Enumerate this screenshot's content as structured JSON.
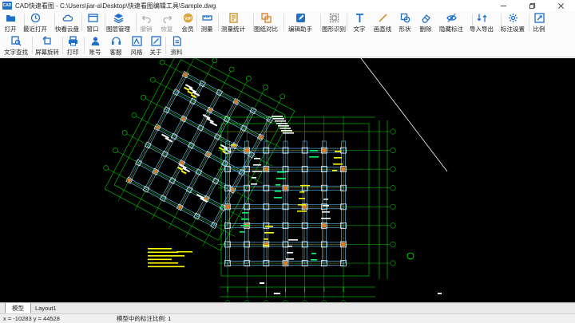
{
  "window": {
    "logo_text": "CAD",
    "title": "CAD快速看图 - C:\\Users\\jiar-a\\Desktop\\快速看图编辑工具\\Sample.dwg"
  },
  "toolbar": {
    "row1": [
      {
        "key": "open",
        "label": "打开",
        "icon": "folder-icon",
        "color": "#1f6fc9",
        "enabled": true
      },
      {
        "key": "recent",
        "label": "最近打开",
        "icon": "clock-icon",
        "color": "#1f6fc9",
        "enabled": true
      },
      {
        "key": "cloud",
        "label": "快看云盘",
        "icon": "cloud-icon",
        "color": "#1f6fc9",
        "enabled": true
      },
      {
        "key": "window",
        "label": "窗口",
        "icon": "window-icon",
        "color": "#1f6fc9",
        "enabled": true
      },
      {
        "key": "layers",
        "label": "图层管理",
        "icon": "layers-icon",
        "color": "#1f6fc9",
        "enabled": true
      },
      {
        "key": "undo",
        "label": "撤销",
        "icon": "undo-icon",
        "color": "#b0b0b0",
        "enabled": false
      },
      {
        "key": "redo",
        "label": "恢复",
        "icon": "redo-icon",
        "color": "#b0b0b0",
        "enabled": false
      },
      {
        "key": "vip",
        "label": "会员",
        "icon": "vip-icon",
        "color": "#d9a441",
        "enabled": true
      },
      {
        "key": "measure",
        "label": "测量",
        "icon": "ruler-icon",
        "color": "#1f6fc9",
        "enabled": true
      },
      {
        "key": "measure-stats",
        "label": "测量统计",
        "icon": "measure-stats-icon",
        "color": "#c98a1f",
        "enabled": true
      },
      {
        "key": "compare",
        "label": "图纸对比",
        "icon": "compare-icon",
        "color": "#e07a1f",
        "enabled": true
      },
      {
        "key": "edit-assist",
        "label": "编辑助手",
        "icon": "edit-assist-icon",
        "color": "#1f6fc9",
        "enabled": true
      },
      {
        "key": "shape-recog",
        "label": "图形识别",
        "icon": "shape-recog-icon",
        "color": "#888888",
        "enabled": true
      },
      {
        "key": "text",
        "label": "文字",
        "icon": "text-icon",
        "color": "#1f6fc9",
        "enabled": true
      },
      {
        "key": "line",
        "label": "画直线",
        "icon": "line-icon",
        "color": "#c98a1f",
        "enabled": true
      },
      {
        "key": "shape",
        "label": "形状",
        "icon": "shape-icon",
        "color": "#1f6fc9",
        "enabled": true
      },
      {
        "key": "erase",
        "label": "删除",
        "icon": "eraser-icon",
        "color": "#1f6fc9",
        "enabled": true
      },
      {
        "key": "hide-mark",
        "label": "隐藏标注",
        "icon": "eye-off-icon",
        "color": "#1f6fc9",
        "enabled": true
      },
      {
        "key": "import-export",
        "label": "导入导出",
        "icon": "import-export-icon",
        "color": "#1f6fc9",
        "enabled": true
      },
      {
        "key": "mark-settings",
        "label": "标注设置",
        "icon": "gear-icon",
        "color": "#1f6fc9",
        "enabled": true
      },
      {
        "key": "scale",
        "label": "比例",
        "icon": "scale-icon",
        "color": "#1f6fc9",
        "enabled": true
      }
    ],
    "row2": [
      {
        "key": "text-search",
        "label": "文字查找",
        "icon": "text-search-icon",
        "color": "#1f6fc9",
        "enabled": true
      },
      {
        "key": "rotate",
        "label": "屏幕旋转",
        "icon": "rotate-icon",
        "color": "#1f6fc9",
        "enabled": true
      },
      {
        "key": "print",
        "label": "打印",
        "icon": "printer-icon",
        "color": "#1f6fc9",
        "enabled": true
      },
      {
        "key": "account",
        "label": "账号",
        "icon": "user-icon",
        "color": "#1f6fc9",
        "enabled": true
      },
      {
        "key": "service",
        "label": "客服",
        "icon": "headset-icon",
        "color": "#1f6fc9",
        "enabled": true
      },
      {
        "key": "style",
        "label": "风格",
        "icon": "style-icon",
        "color": "#1f6fc9",
        "enabled": true
      },
      {
        "key": "about",
        "label": "关于",
        "icon": "info-icon",
        "color": "#1f6fc9",
        "enabled": true
      },
      {
        "key": "docs",
        "label": "资料",
        "icon": "docs-icon",
        "color": "#1f6fc9",
        "enabled": true
      }
    ]
  },
  "tabs": [
    {
      "label": "模型",
      "active": true
    },
    {
      "label": "Layout1",
      "active": false
    }
  ],
  "status": {
    "coords": "x = -10283  y = 44528",
    "scale_text": "模型中的标注比例: 1"
  },
  "colors": {
    "canvas_bg": "#000000",
    "accent": "#1f6fc9"
  }
}
